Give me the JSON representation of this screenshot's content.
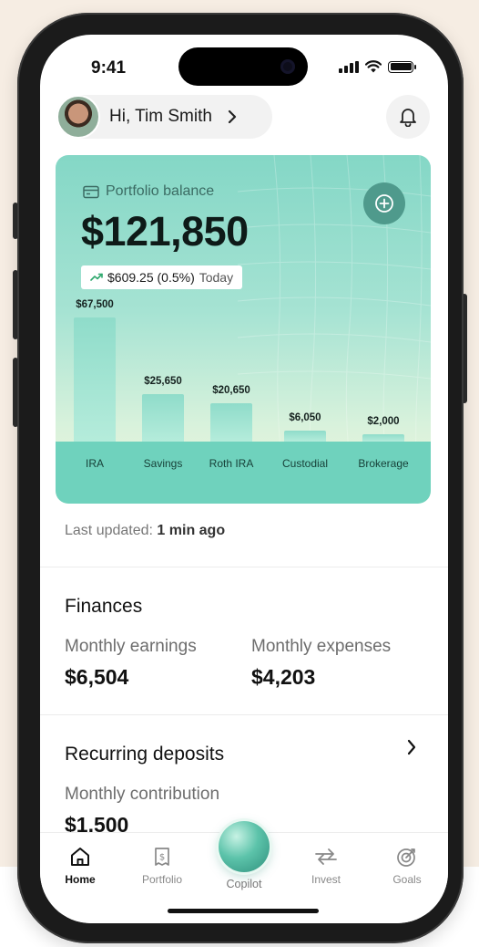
{
  "status_bar": {
    "time": "9:41"
  },
  "header": {
    "greeting": "Hi, Tim Smith"
  },
  "portfolio": {
    "label": "Portfolio balance",
    "balance": "$121,850",
    "change_amount": "$609.25 (0.5%)",
    "change_period": "Today",
    "accent_color": "#4f9a8c"
  },
  "chart_data": {
    "type": "bar",
    "categories": [
      "IRA",
      "Savings",
      "Roth IRA",
      "Custodial",
      "Brokerage"
    ],
    "values": [
      67500,
      25650,
      20650,
      6050,
      2000
    ],
    "value_labels": [
      "$67,500",
      "$25,650",
      "$20,650",
      "$6,050",
      "$2,000"
    ],
    "ylim": [
      0,
      67500
    ]
  },
  "last_updated": {
    "label": "Last updated:",
    "value": "1 min ago"
  },
  "finances": {
    "title": "Finances",
    "earnings_label": "Monthly earnings",
    "earnings_value": "$6,504",
    "expenses_label": "Monthly expenses",
    "expenses_value": "$4,203"
  },
  "recurring": {
    "title": "Recurring deposits",
    "contribution_label": "Monthly contribution",
    "contribution_value": "$1,500"
  },
  "nav": {
    "items": [
      {
        "label": "Home",
        "icon": "home-icon",
        "active": true
      },
      {
        "label": "Portfolio",
        "icon": "portfolio-icon",
        "active": false
      },
      {
        "label": "Copilot",
        "icon": "copilot-orb-icon",
        "active": false
      },
      {
        "label": "Invest",
        "icon": "transfer-arrows-icon",
        "active": false
      },
      {
        "label": "Goals",
        "icon": "goals-target-icon",
        "active": false
      }
    ]
  }
}
